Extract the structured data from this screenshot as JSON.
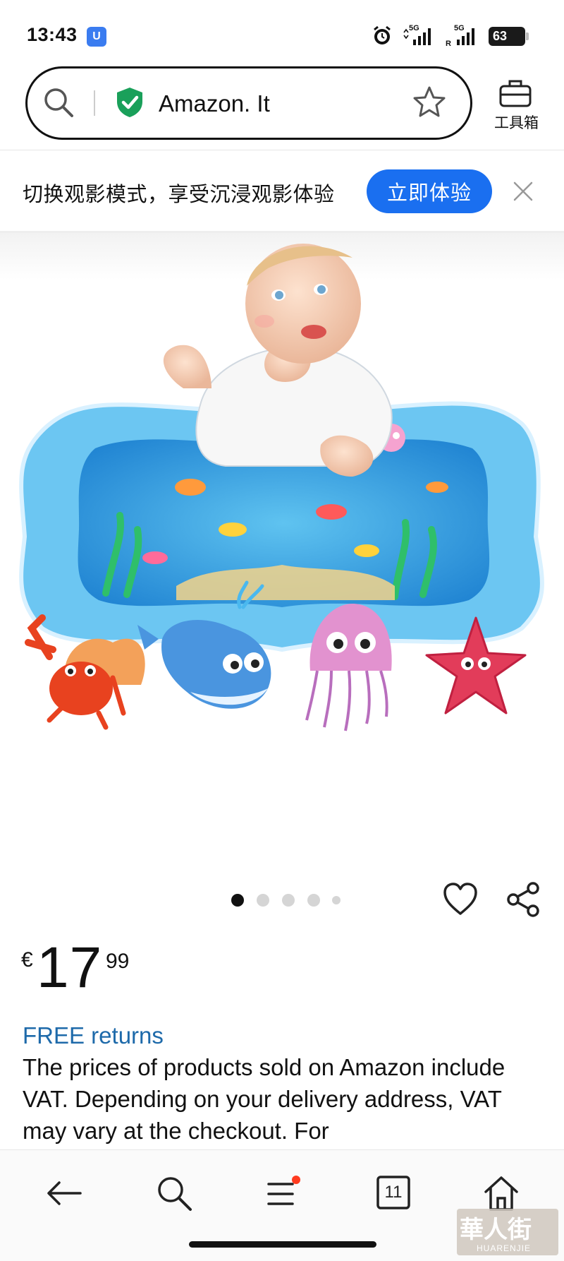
{
  "status_bar": {
    "time": "13:43",
    "vpn_badge": "U",
    "sim1": "5G",
    "sim2": "5G",
    "battery": "63"
  },
  "address_bar": {
    "url": "Amazon. It",
    "toolbox_label": "工具箱"
  },
  "banner": {
    "text": "切换观影模式，享受沉浸观影体验",
    "button": "立即体验"
  },
  "carousel": {
    "total": 5,
    "active_index": 0
  },
  "product": {
    "currency": "€",
    "price_whole": "17",
    "price_fraction": "99",
    "free_returns": "FREE returns",
    "description": "The prices of products sold on Amazon include VAT. Depending on your delivery address, VAT may vary at the checkout. For"
  },
  "bottom_nav": {
    "tabs_count": "11"
  },
  "watermark": {
    "text": "華人街",
    "subtext": "HUARENJIE"
  },
  "colors": {
    "accent": "#1a6ff0",
    "link": "#1e6aaa",
    "shield": "#1aa05a"
  }
}
